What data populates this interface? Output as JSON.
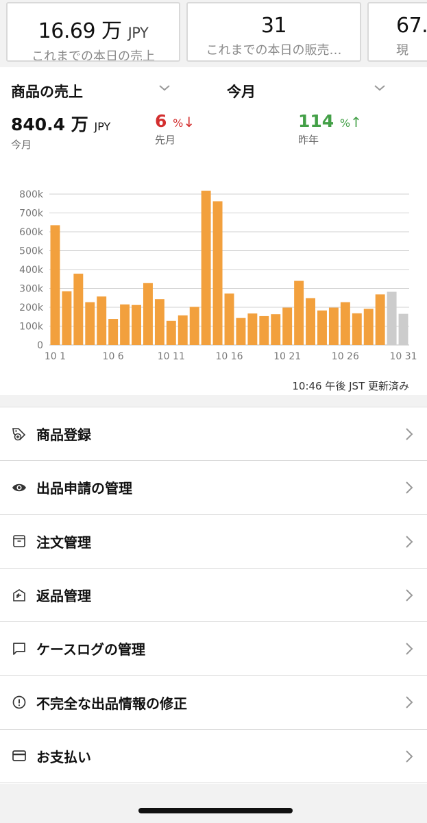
{
  "kpis": [
    {
      "value": "16.69 万",
      "unit": "JPY",
      "label": "これまでの本日の売上"
    },
    {
      "value": "31",
      "unit": "",
      "label": "これまでの本日の販売…"
    },
    {
      "value": "67.",
      "unit": "",
      "label": "現"
    }
  ],
  "sales": {
    "metric_selector": "商品の売上",
    "period_selector": "今月",
    "total": {
      "value": "840.4 万",
      "unit": "JPY",
      "label": "今月"
    },
    "vs_last_month": {
      "value": "6",
      "unit": "%",
      "arrow": "↓",
      "label": "先月",
      "color": "#d32f2f"
    },
    "vs_last_year": {
      "value": "114",
      "unit": "%",
      "arrow": "↑",
      "label": "昨年",
      "color": "#43a047"
    },
    "updated": "10:46 午後 JST 更新済み"
  },
  "chart_data": {
    "type": "bar",
    "categories": [
      "10 1",
      "10 2",
      "10 3",
      "10 4",
      "10 5",
      "10 6",
      "10 7",
      "10 8",
      "10 9",
      "10 10",
      "10 11",
      "10 12",
      "10 13",
      "10 14",
      "10 15",
      "10 16",
      "10 17",
      "10 18",
      "10 19",
      "10 20",
      "10 21",
      "10 22",
      "10 23",
      "10 24",
      "10 25",
      "10 26",
      "10 27",
      "10 28",
      "10 29",
      "10 30",
      "10 31"
    ],
    "x_tick_labels": [
      "10 1",
      "10 6",
      "10 11",
      "10 16",
      "10 21",
      "10 26",
      "10 31"
    ],
    "values": [
      635000,
      285000,
      378000,
      227000,
      257000,
      138000,
      215000,
      212000,
      328000,
      243000,
      128000,
      157000,
      202000,
      818000,
      762000,
      273000,
      143000,
      167000,
      153000,
      163000,
      198000,
      340000,
      248000,
      183000,
      198000,
      227000,
      168000,
      192000,
      268000,
      282000,
      165000
    ],
    "bar_colors": [
      "#f2a03d",
      "#f2a03d",
      "#f2a03d",
      "#f2a03d",
      "#f2a03d",
      "#f2a03d",
      "#f2a03d",
      "#f2a03d",
      "#f2a03d",
      "#f2a03d",
      "#f2a03d",
      "#f2a03d",
      "#f2a03d",
      "#f2a03d",
      "#f2a03d",
      "#f2a03d",
      "#f2a03d",
      "#f2a03d",
      "#f2a03d",
      "#f2a03d",
      "#f2a03d",
      "#f2a03d",
      "#f2a03d",
      "#f2a03d",
      "#f2a03d",
      "#f2a03d",
      "#f2a03d",
      "#f2a03d",
      "#f2a03d",
      "#cccccc",
      "#cccccc"
    ],
    "y_ticks": [
      "0",
      "100k",
      "200k",
      "300k",
      "400k",
      "500k",
      "600k",
      "700k",
      "800k"
    ],
    "ylim": [
      0,
      800000
    ],
    "grid": true
  },
  "menu": [
    {
      "label": "商品登録",
      "icon": "tag-add-icon"
    },
    {
      "label": "出品申請の管理",
      "icon": "eye-icon"
    },
    {
      "label": "注文管理",
      "icon": "box-icon"
    },
    {
      "label": "返品管理",
      "icon": "return-box-icon"
    },
    {
      "label": "ケースログの管理",
      "icon": "chat-bubble-icon"
    },
    {
      "label": "不完全な出品情報の修正",
      "icon": "alert-circle-icon"
    },
    {
      "label": "お支払い",
      "icon": "credit-card-icon"
    }
  ]
}
